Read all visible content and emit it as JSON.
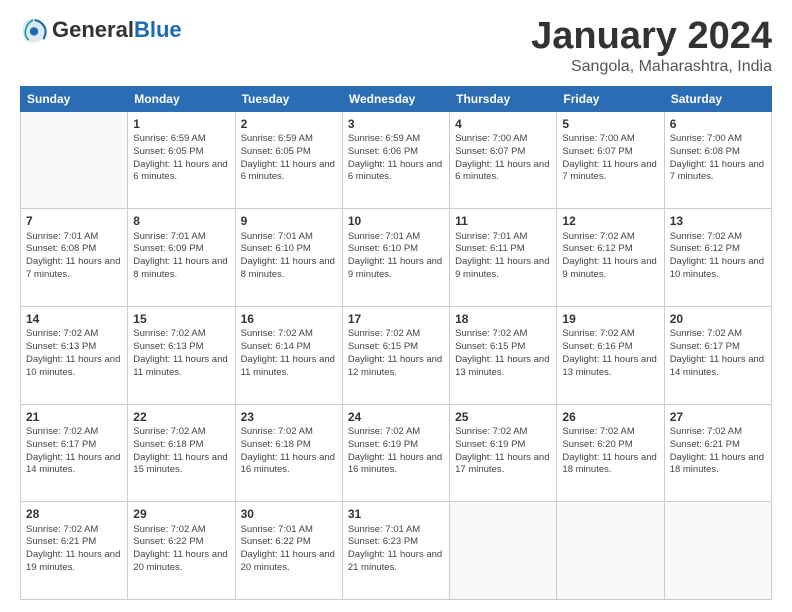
{
  "header": {
    "logo_general": "General",
    "logo_blue": "Blue",
    "month": "January 2024",
    "location": "Sangola, Maharashtra, India"
  },
  "weekdays": [
    "Sunday",
    "Monday",
    "Tuesday",
    "Wednesday",
    "Thursday",
    "Friday",
    "Saturday"
  ],
  "weeks": [
    [
      {
        "day": null
      },
      {
        "day": "1",
        "sunrise": "Sunrise: 6:59 AM",
        "sunset": "Sunset: 6:05 PM",
        "daylight": "Daylight: 11 hours and 6 minutes."
      },
      {
        "day": "2",
        "sunrise": "Sunrise: 6:59 AM",
        "sunset": "Sunset: 6:05 PM",
        "daylight": "Daylight: 11 hours and 6 minutes."
      },
      {
        "day": "3",
        "sunrise": "Sunrise: 6:59 AM",
        "sunset": "Sunset: 6:06 PM",
        "daylight": "Daylight: 11 hours and 6 minutes."
      },
      {
        "day": "4",
        "sunrise": "Sunrise: 7:00 AM",
        "sunset": "Sunset: 6:07 PM",
        "daylight": "Daylight: 11 hours and 6 minutes."
      },
      {
        "day": "5",
        "sunrise": "Sunrise: 7:00 AM",
        "sunset": "Sunset: 6:07 PM",
        "daylight": "Daylight: 11 hours and 7 minutes."
      },
      {
        "day": "6",
        "sunrise": "Sunrise: 7:00 AM",
        "sunset": "Sunset: 6:08 PM",
        "daylight": "Daylight: 11 hours and 7 minutes."
      }
    ],
    [
      {
        "day": "7",
        "sunrise": "Sunrise: 7:01 AM",
        "sunset": "Sunset: 6:08 PM",
        "daylight": "Daylight: 11 hours and 7 minutes."
      },
      {
        "day": "8",
        "sunrise": "Sunrise: 7:01 AM",
        "sunset": "Sunset: 6:09 PM",
        "daylight": "Daylight: 11 hours and 8 minutes."
      },
      {
        "day": "9",
        "sunrise": "Sunrise: 7:01 AM",
        "sunset": "Sunset: 6:10 PM",
        "daylight": "Daylight: 11 hours and 8 minutes."
      },
      {
        "day": "10",
        "sunrise": "Sunrise: 7:01 AM",
        "sunset": "Sunset: 6:10 PM",
        "daylight": "Daylight: 11 hours and 9 minutes."
      },
      {
        "day": "11",
        "sunrise": "Sunrise: 7:01 AM",
        "sunset": "Sunset: 6:11 PM",
        "daylight": "Daylight: 11 hours and 9 minutes."
      },
      {
        "day": "12",
        "sunrise": "Sunrise: 7:02 AM",
        "sunset": "Sunset: 6:12 PM",
        "daylight": "Daylight: 11 hours and 9 minutes."
      },
      {
        "day": "13",
        "sunrise": "Sunrise: 7:02 AM",
        "sunset": "Sunset: 6:12 PM",
        "daylight": "Daylight: 11 hours and 10 minutes."
      }
    ],
    [
      {
        "day": "14",
        "sunrise": "Sunrise: 7:02 AM",
        "sunset": "Sunset: 6:13 PM",
        "daylight": "Daylight: 11 hours and 10 minutes."
      },
      {
        "day": "15",
        "sunrise": "Sunrise: 7:02 AM",
        "sunset": "Sunset: 6:13 PM",
        "daylight": "Daylight: 11 hours and 11 minutes."
      },
      {
        "day": "16",
        "sunrise": "Sunrise: 7:02 AM",
        "sunset": "Sunset: 6:14 PM",
        "daylight": "Daylight: 11 hours and 11 minutes."
      },
      {
        "day": "17",
        "sunrise": "Sunrise: 7:02 AM",
        "sunset": "Sunset: 6:15 PM",
        "daylight": "Daylight: 11 hours and 12 minutes."
      },
      {
        "day": "18",
        "sunrise": "Sunrise: 7:02 AM",
        "sunset": "Sunset: 6:15 PM",
        "daylight": "Daylight: 11 hours and 13 minutes."
      },
      {
        "day": "19",
        "sunrise": "Sunrise: 7:02 AM",
        "sunset": "Sunset: 6:16 PM",
        "daylight": "Daylight: 11 hours and 13 minutes."
      },
      {
        "day": "20",
        "sunrise": "Sunrise: 7:02 AM",
        "sunset": "Sunset: 6:17 PM",
        "daylight": "Daylight: 11 hours and 14 minutes."
      }
    ],
    [
      {
        "day": "21",
        "sunrise": "Sunrise: 7:02 AM",
        "sunset": "Sunset: 6:17 PM",
        "daylight": "Daylight: 11 hours and 14 minutes."
      },
      {
        "day": "22",
        "sunrise": "Sunrise: 7:02 AM",
        "sunset": "Sunset: 6:18 PM",
        "daylight": "Daylight: 11 hours and 15 minutes."
      },
      {
        "day": "23",
        "sunrise": "Sunrise: 7:02 AM",
        "sunset": "Sunset: 6:18 PM",
        "daylight": "Daylight: 11 hours and 16 minutes."
      },
      {
        "day": "24",
        "sunrise": "Sunrise: 7:02 AM",
        "sunset": "Sunset: 6:19 PM",
        "daylight": "Daylight: 11 hours and 16 minutes."
      },
      {
        "day": "25",
        "sunrise": "Sunrise: 7:02 AM",
        "sunset": "Sunset: 6:19 PM",
        "daylight": "Daylight: 11 hours and 17 minutes."
      },
      {
        "day": "26",
        "sunrise": "Sunrise: 7:02 AM",
        "sunset": "Sunset: 6:20 PM",
        "daylight": "Daylight: 11 hours and 18 minutes."
      },
      {
        "day": "27",
        "sunrise": "Sunrise: 7:02 AM",
        "sunset": "Sunset: 6:21 PM",
        "daylight": "Daylight: 11 hours and 18 minutes."
      }
    ],
    [
      {
        "day": "28",
        "sunrise": "Sunrise: 7:02 AM",
        "sunset": "Sunset: 6:21 PM",
        "daylight": "Daylight: 11 hours and 19 minutes."
      },
      {
        "day": "29",
        "sunrise": "Sunrise: 7:02 AM",
        "sunset": "Sunset: 6:22 PM",
        "daylight": "Daylight: 11 hours and 20 minutes."
      },
      {
        "day": "30",
        "sunrise": "Sunrise: 7:01 AM",
        "sunset": "Sunset: 6:22 PM",
        "daylight": "Daylight: 11 hours and 20 minutes."
      },
      {
        "day": "31",
        "sunrise": "Sunrise: 7:01 AM",
        "sunset": "Sunset: 6:23 PM",
        "daylight": "Daylight: 11 hours and 21 minutes."
      },
      {
        "day": null
      },
      {
        "day": null
      },
      {
        "day": null
      }
    ]
  ]
}
